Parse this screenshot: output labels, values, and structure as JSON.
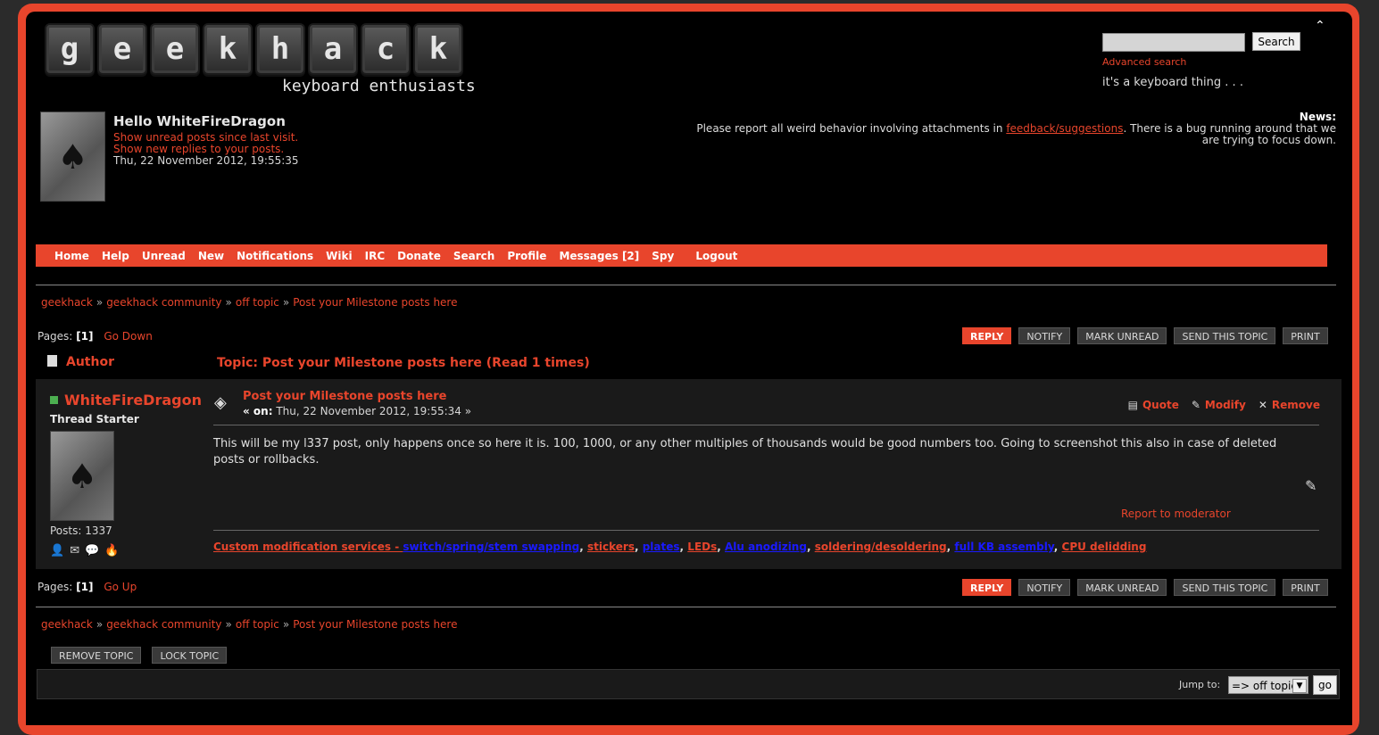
{
  "logo": {
    "letters": [
      "g",
      "e",
      "e",
      "k",
      "h",
      "a",
      "c",
      "k"
    ],
    "tagline": "keyboard enthusiasts"
  },
  "search": {
    "placeholder": "",
    "button": "Search",
    "advanced": "Advanced search"
  },
  "motto": "it's a keyboard thing . . .",
  "collapse_icon": "chevron-up-icon",
  "user": {
    "greeting": "Hello WhiteFireDragon",
    "unread_link": "Show unread posts since last visit.",
    "replies_link": "Show new replies to your posts.",
    "datetime": "Thu, 22 November 2012, 19:55:35"
  },
  "news": {
    "label": "News:",
    "text_before": "Please report all weird behavior involving attachments in ",
    "link": "feedback/suggestions",
    "text_after": ". There is a bug running around that we are trying to focus down."
  },
  "menu": [
    "Home",
    "Help",
    "Unread",
    "New",
    "Notifications",
    "Wiki",
    "IRC",
    "Donate",
    "Search",
    "Profile",
    "Messages [2]",
    "Spy",
    "Logout"
  ],
  "breadcrumb": [
    "geekhack",
    "geekhack community",
    "off topic",
    "Post your Milestone posts here"
  ],
  "pagination": {
    "label": "Pages:",
    "current": "[1]",
    "go_down": "Go Down",
    "go_up": "Go Up"
  },
  "topic_buttons": [
    "REPLY",
    "NOTIFY",
    "MARK UNREAD",
    "SEND THIS TOPIC",
    "PRINT"
  ],
  "header": {
    "author": "Author",
    "topic": "Topic: Post your Milestone posts here  (Read 1 times)"
  },
  "post": {
    "author": "WhiteFireDragon",
    "rank": "Thread Starter",
    "posts": "Posts: 1337",
    "subject": "Post your Milestone posts here",
    "date_prefix": "« on:",
    "date": "Thu, 22 November 2012, 19:55:34 »",
    "actions": {
      "quote": "Quote",
      "modify": "Modify",
      "remove": "Remove"
    },
    "body": "This will be my l337 post, only happens once so here it is. 100, 1000, or any other multiples of thousands would be good numbers too. Going to screenshot this also in case of deleted posts or rollbacks.",
    "report": "Report to moderator",
    "signature": {
      "lead": "Custom modification services - ",
      "items": [
        {
          "text": "switch/spring/stem swapping",
          "color": "blue"
        },
        {
          "text": "stickers",
          "color": "red"
        },
        {
          "text": "plates",
          "color": "blue"
        },
        {
          "text": "LEDs",
          "color": "red"
        },
        {
          "text": "Alu anodizing",
          "color": "blue"
        },
        {
          "text": "soldering/desoldering",
          "color": "red"
        },
        {
          "text": "full KB assembly",
          "color": "blue"
        },
        {
          "text": "CPU delidding",
          "color": "red"
        }
      ]
    }
  },
  "mod_buttons": {
    "remove": "REMOVE TOPIC",
    "lock": "LOCK TOPIC"
  },
  "jump": {
    "label": "Jump to:",
    "selected": "=> off topic",
    "go": "go"
  },
  "colors": {
    "accent": "#e8452c",
    "background": "#000000",
    "post_bg": "#1a1a1a"
  }
}
